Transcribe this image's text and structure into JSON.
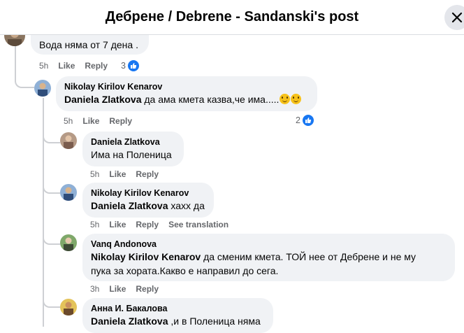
{
  "header": {
    "title": "Дебрене / Debrene - Sandanski's post"
  },
  "labels": {
    "like": "Like",
    "reply": "Reply",
    "see_translation": "See translation"
  },
  "comments": [
    {
      "author": "",
      "text": "Вода няма от 7 дена .",
      "time": "5h",
      "reactions": "3"
    },
    {
      "author": "Nikolay Kirilov Kenarov",
      "tag": "Daniela Zlatkova",
      "text": "да ама кмета казва,че има.....",
      "time": "5h",
      "reactions": "2"
    },
    {
      "author": "Daniela Zlatkova",
      "text": "Има на Поленица",
      "time": "5h"
    },
    {
      "author": "Nikolay Kirilov Kenarov",
      "tag": "Daniela Zlatkova",
      "text": "хахх да",
      "time": "5h"
    },
    {
      "author": "Vanq Andonova",
      "tag": "Nikolay Kirilov Kenarov",
      "text": "да сменим кмета. ТОЙ нее от Дебрене и не му",
      "text2": "пука за хората.Какво е направил до сега.",
      "time": "3h"
    },
    {
      "author": "Анна И. Бакалова",
      "tag": "Daniela Zlatkova",
      "text": ",и в Поленица няма"
    }
  ],
  "colors": {
    "like_blue": "#1877f2",
    "bubble": "#f0f2f5",
    "meta_gray": "#65676b"
  }
}
